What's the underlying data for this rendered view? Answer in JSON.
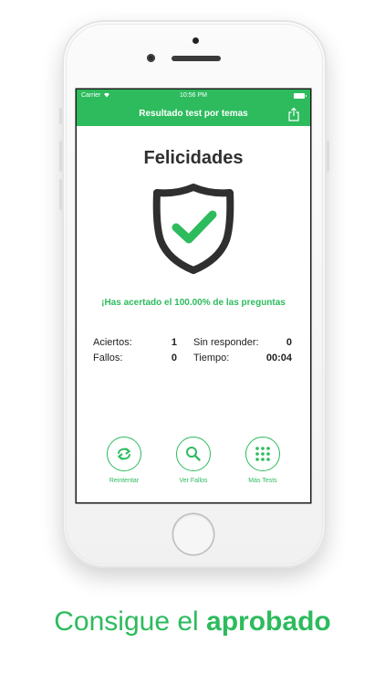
{
  "status_bar": {
    "carrier": "Carrier",
    "wifi_icon": "wifi-icon",
    "time": "10:56 PM",
    "battery_icon": "battery-icon"
  },
  "nav": {
    "title": "Resultado test por temas",
    "share_icon": "share-icon"
  },
  "result": {
    "title": "Felicidades",
    "icon": "shield-check-icon",
    "message": "¡Has acertado el 100.00% de las preguntas"
  },
  "stats": {
    "aciertos": {
      "label": "Aciertos:",
      "value": "1"
    },
    "fallos": {
      "label": "Fallos:",
      "value": "0"
    },
    "sin_responder": {
      "label": "Sin responder:",
      "value": "0"
    },
    "tiempo": {
      "label": "Tiempo:",
      "value": "00:04"
    }
  },
  "actions": [
    {
      "label": "Reintentar",
      "icon": "retry-icon"
    },
    {
      "label": "Ver Fallos",
      "icon": "search-icon"
    },
    {
      "label": "Más Tests",
      "icon": "grid-icon"
    }
  ],
  "tagline": {
    "prefix": "Consigue el ",
    "bold": "aprobado"
  },
  "colors": {
    "accent": "#2dbb5d",
    "shield_stroke": "#2f2f2f",
    "text": "#222222"
  }
}
